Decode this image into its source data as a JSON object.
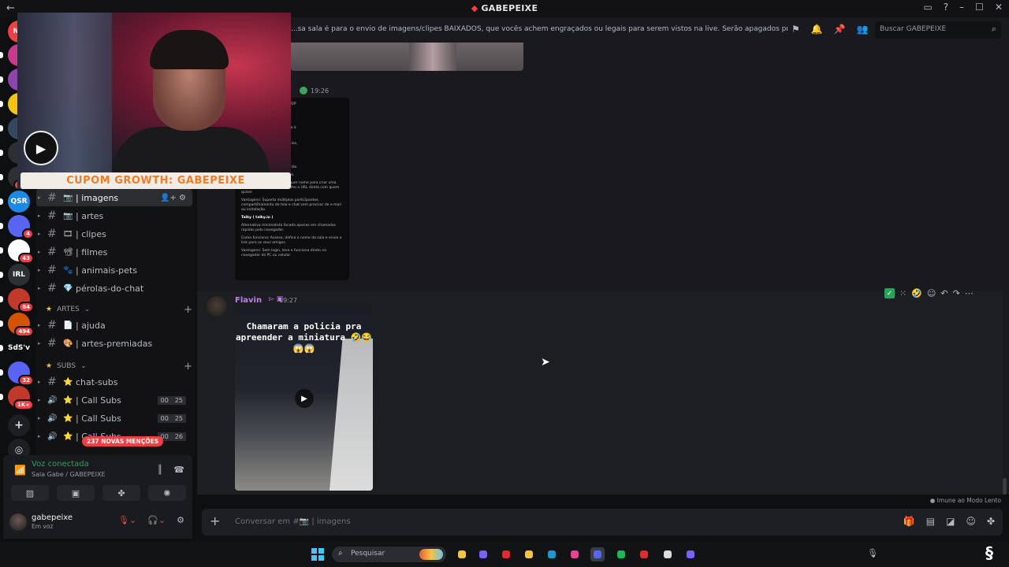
{
  "window": {
    "title": "GABEPEIXE"
  },
  "header": {
    "topic": "...sa sala é para o envio de imagens/clipes BAIXADOS, que vocês achem engraçados ou legais para serem vistos na live. Serão apagados prints de outras rede...",
    "search_placeholder": "Buscar GABEPEIXE"
  },
  "overlay": {
    "banner_text": "CUPOM GROWTH: GABEPEIXE"
  },
  "rail": {
    "top_label": "NO",
    "items": [
      {
        "label": "",
        "badge": "",
        "color": "#c93a8a"
      },
      {
        "label": "",
        "badge": "",
        "color": "#8e44ad"
      },
      {
        "label": "",
        "badge": "",
        "color": "#f1c40f"
      },
      {
        "label": "",
        "badge": "",
        "color": "#34495e"
      },
      {
        "label": "",
        "badge": "",
        "color": "#2c2f33"
      },
      {
        "label": "",
        "badge": "5K+",
        "color": "#2c2f33"
      },
      {
        "label": "QSR",
        "badge": "",
        "color": "#1e88e5"
      },
      {
        "label": "",
        "badge": "4",
        "color": "#5865f2"
      },
      {
        "label": "",
        "badge": "43",
        "color": "#ffffff"
      },
      {
        "label": "IRL",
        "badge": "",
        "color": "#2c2f33"
      },
      {
        "label": "",
        "badge": "84",
        "color": "#c0392b"
      },
      {
        "label": "",
        "badge": "494",
        "color": "#d35400"
      },
      {
        "label": "SdS'v",
        "badge": "",
        "color": "#0e0f11"
      },
      {
        "label": "",
        "badge": "32",
        "color": "#5865f2"
      },
      {
        "label": "",
        "badge": "1K+",
        "color": "#c0392b"
      }
    ]
  },
  "sidebar": {
    "channels": [
      {
        "name": "| imagens",
        "emoji": "📷"
      },
      {
        "name": "| artes",
        "emoji": "📷"
      },
      {
        "name": "| clipes",
        "emoji": "🎞"
      },
      {
        "name": "| filmes",
        "emoji": "📽"
      },
      {
        "name": "| animais-pets",
        "emoji": "🐾"
      },
      {
        "name": "pérolas-do-chat",
        "emoji": "💎"
      }
    ],
    "category_artes": "ARTES",
    "artes_channels": [
      {
        "name": "| ajuda",
        "emoji": "📄"
      },
      {
        "name": "| artes-premiadas",
        "emoji": "🎨"
      }
    ],
    "category_subs": "SUBS",
    "subs_channels": [
      {
        "name": "chat-subs",
        "kind": "text"
      },
      {
        "name": "| Call Subs",
        "kind": "voice",
        "c1": "00",
        "c2": "25"
      },
      {
        "name": "| Call Subs",
        "kind": "voice",
        "c1": "00",
        "c2": "25"
      },
      {
        "name": "| Call Subs",
        "kind": "voice",
        "c1": "00",
        "c2": "26"
      }
    ],
    "mentions": "237 NOVAS MENÇÕES"
  },
  "voice": {
    "status": "Voz conectada",
    "room": "Sala Gabe / GABEPEIXE"
  },
  "user": {
    "name": "gabepeixe",
    "status": "Em voz"
  },
  "messages": {
    "first_time": "19:26",
    "doc_lines": [
      "para transmissão de vídeo P2P",
      "a WebRTC.",
      "cessa o site, clica em \"Add",
      "m grupo, concede permissão à",
      "rado para os seus amigos.",
      "o, sem cadastro, sem anúncios,",
      "elente qualidade de áudio e",
      "Jitsi Meet ( meet.jit.si )",
      "nada de código aberto que não",
      "ível, nem para os convidados.",
      "Como funciona: Digite qualquer nome para criar uma sala instantânea e compartilhe a URL direta com quem quiser.",
      "Vantagens: Suporta múltiplos participantes, compartilhamento de tela e chat sem precisar de e-mail ou instalação.",
      "Talky ( talky.io )",
      "Alternativa minimalista focada apenas em chamadas rápidas pelo navegador.",
      "Como funciona: Acesse, defina o nome da sala e envie o link para os seus amigos.",
      "Vantagens: Sem login, leve e funciona direto no navegador do PC ou celular."
    ],
    "author": "Flavin",
    "second_time": "19:27",
    "video_caption": "Chamaram a policia pra apreender a miniatura 🤣😂😱😱"
  },
  "chat": {
    "slowmode": "Imune ao Modo Lento",
    "composer_placeholder": "Conversar em #📷 | imagens"
  },
  "taskbar": {
    "search_placeholder": "Pesquisar",
    "apps": [
      {
        "icon": "file-explorer-icon",
        "color": "#f6c343"
      },
      {
        "icon": "copilot-icon",
        "color": "#7b61ff"
      },
      {
        "icon": "opera-icon",
        "color": "#e02c2c"
      },
      {
        "icon": "folder-icon",
        "color": "#f6c343"
      },
      {
        "icon": "steam-icon",
        "color": "#1b9bd1"
      },
      {
        "icon": "capcut-icon",
        "color": "#e84393"
      },
      {
        "icon": "discord-icon",
        "color": "#5865f2"
      },
      {
        "icon": "spotify-icon",
        "color": "#1db954"
      },
      {
        "icon": "red-app-icon",
        "color": "#e02c2c"
      },
      {
        "icon": "obs-icon",
        "color": "#dddddd"
      },
      {
        "icon": "arrow-app-icon",
        "color": "#7b61ff"
      }
    ]
  }
}
